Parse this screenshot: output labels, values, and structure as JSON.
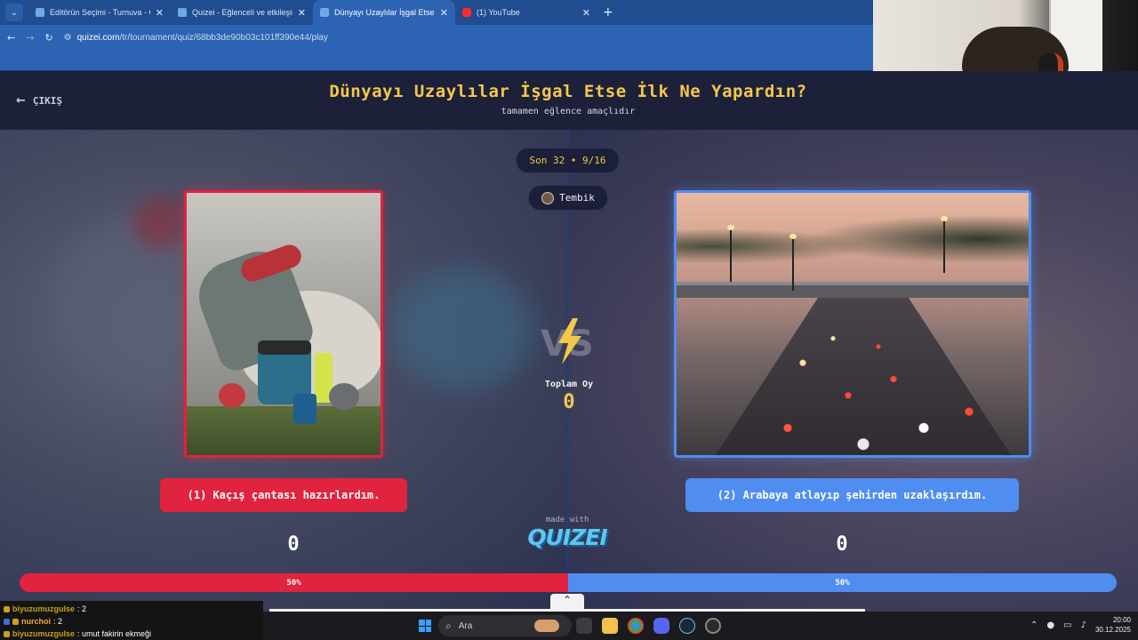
{
  "browser": {
    "tabs": [
      {
        "title": "Editörün Seçimi - Turnuva - Qu",
        "active": false,
        "favicon": "quizei"
      },
      {
        "title": "Quizei - Eğlenceli ve etkileşimli",
        "active": false,
        "favicon": "quizei"
      },
      {
        "title": "Dünyayı Uzaylılar İşgal Etse İlk",
        "active": true,
        "favicon": "quizei"
      },
      {
        "title": "(1) YouTube",
        "active": false,
        "favicon": "youtube"
      }
    ],
    "url_host": "quizei.com",
    "url_path": "/tr/tournament/quiz/68bb3de90b03c101ff390e44/play"
  },
  "header": {
    "exit_label": "ÇIKIŞ",
    "title": "Dünyayı Uzaylılar İşgal Etse İlk Ne Yapardın?",
    "subtitle": "tamamen eğlence amaçlıdır"
  },
  "round": {
    "label": "Son 32 • 9/16",
    "user": "Tembik"
  },
  "vs": {
    "total_label": "Toplam Oy",
    "total_value": "0"
  },
  "options": [
    {
      "label": "(1) Kaçış çantası hazırlardım.",
      "votes": "0",
      "percent_label": "50%",
      "percent": 50,
      "color": "#e0233f"
    },
    {
      "label": "(2) Arabaya atlayıp şehirden uzaklaşırdım.",
      "votes": "0",
      "percent_label": "50%",
      "percent": 50,
      "color": "#4f8df0"
    }
  ],
  "branding": {
    "made_with": "made with",
    "logo": "QUIZEI"
  },
  "chat": [
    {
      "user": "biyuzumuzgulse",
      "message": ": 2",
      "user_color": "#c7a21c"
    },
    {
      "user": "nurchoi",
      "message": ": 2",
      "user_color": "#f2a93b"
    },
    {
      "user": "biyuzumuzgulse",
      "message": ": umut fakirin ekmeği",
      "user_color": "#c7a21c"
    }
  ],
  "taskbar": {
    "search_placeholder": "Ara",
    "time": "20:00",
    "date": "30.12.2025"
  }
}
